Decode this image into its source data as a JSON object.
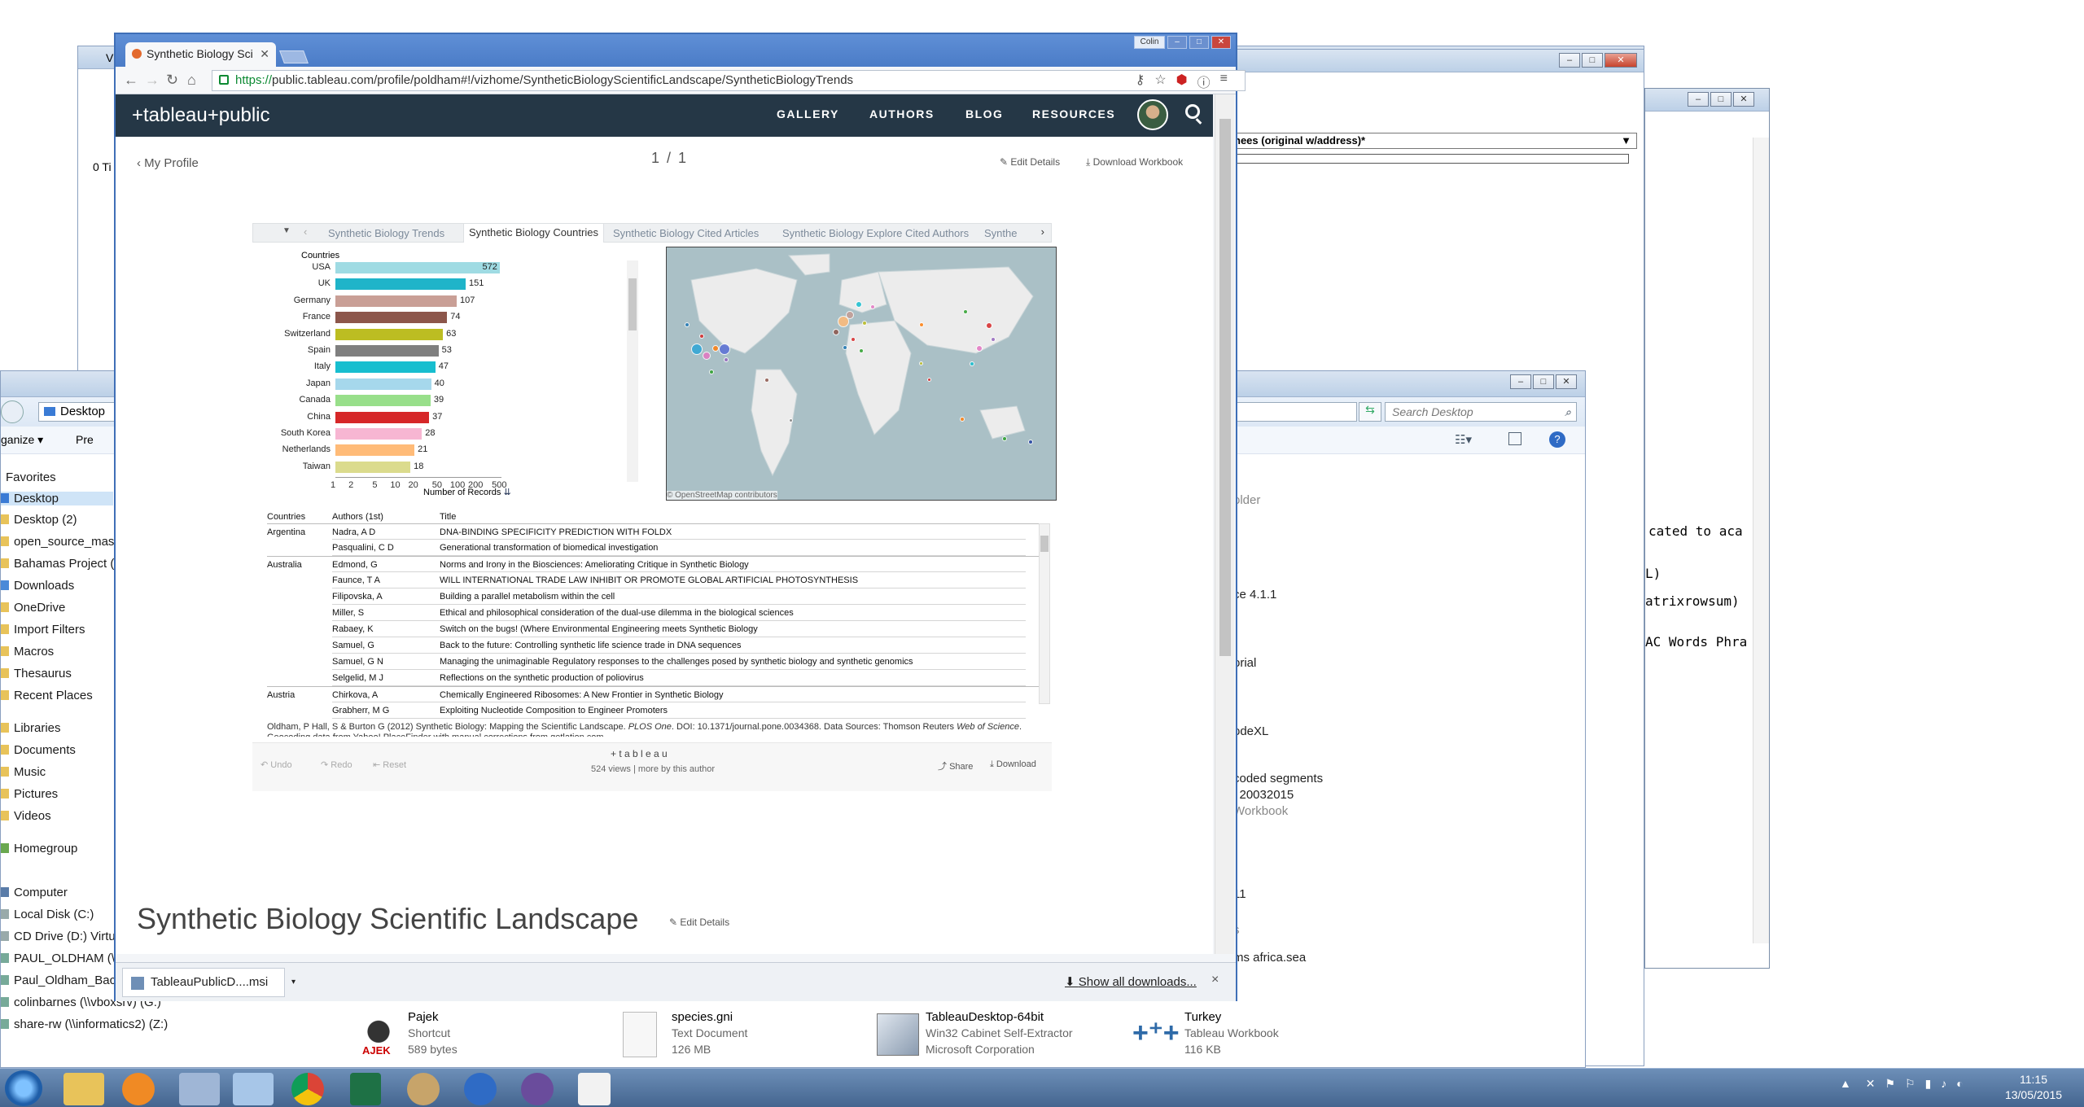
{
  "bg_windows": {
    "back_left_title": "V",
    "tab0_label": "0 Ti",
    "dropdown_label": "hees (original w/address)*",
    "right_text_lines": [
      "cated to aca",
      "L)",
      "atrixrowsum)",
      "AC Words Phra"
    ],
    "explorer_middle_lines": [
      "older",
      "ce 4.1.1",
      "orial",
      "odeXL",
      "coded segments",
      "l 20032015",
      "Workbook",
      "11",
      "s",
      "ms africa.sea"
    ]
  },
  "explorer": {
    "address": "Desktop",
    "search_placeholder": "Search Desktop",
    "toolbar": {
      "organize": "ganize ▾",
      "preview": "Pre"
    },
    "favorites_header": "Favorites",
    "favorites": [
      "Desktop",
      "Desktop (2)",
      "open_source_mast",
      "Bahamas Project (2",
      "Downloads",
      "OneDrive",
      "Import Filters",
      "Macros",
      "Thesaurus",
      "Recent Places"
    ],
    "libraries_header": "Libraries",
    "libraries": [
      "Documents",
      "Music",
      "Pictures",
      "Videos"
    ],
    "homegroup": "Homegroup",
    "computer_header": "Computer",
    "computer": [
      "Local Disk (C:)",
      "CD Drive (D:) Virtu",
      "PAUL_OLDHAM (\\\\",
      "Paul_Oldham_Backup (\\\\vboxsrv) (F:)",
      "colinbarnes (\\\\vboxsrv) (G:)",
      "share-rw (\\\\informatics2) (Z:)"
    ],
    "files": [
      {
        "name": "Pajek",
        "type": "Shortcut",
        "size": "589 bytes"
      },
      {
        "name": "species.gni",
        "type": "Text Document",
        "size": "126 MB"
      },
      {
        "name": "TableauDesktop-64bit",
        "type": "Win32 Cabinet Self-Extractor",
        "size": "Microsoft Corporation"
      },
      {
        "name": "Turkey",
        "type": "Tableau Workbook",
        "size": "116 KB"
      }
    ]
  },
  "browser": {
    "tab_title": "Synthetic Biology Sci",
    "user_chip": "Colin",
    "url_https": "https://",
    "url_rest": "public.tableau.com/profile/poldham#!/vizhome/SyntheticBiologyScientificLandscape/SyntheticBiologyTrends",
    "download_file": "TableauPublicD....msi",
    "show_all_downloads": "Show all downloads...",
    "dl_close": "×"
  },
  "tableau": {
    "logo": "+tableau+public",
    "nav": [
      "GALLERY",
      "AUTHORS",
      "BLOG",
      "RESOURCES"
    ],
    "my_profile": "My Profile",
    "pager": "1 / 1",
    "edit_details": "Edit Details",
    "download_workbook": "Download Workbook",
    "viz_tabs": [
      "Synthetic Biology Trends",
      "Synthetic Biology Countries",
      "Synthetic Biology Cited Articles",
      "Synthetic Biology Explore Cited Authors",
      "Synthe"
    ],
    "active_tab_index": 1,
    "map_credit": "© OpenStreetMap contributors",
    "table": {
      "headers": [
        "Countries",
        "Authors (1st)",
        "Title"
      ],
      "rows": [
        {
          "country": "Argentina",
          "author": "Nadra, A D",
          "title": "DNA-BINDING SPECIFICITY PREDICTION WITH FOLDX"
        },
        {
          "country": "",
          "author": "Pasqualini, C D",
          "title": "Generational transformation of biomedical investigation"
        },
        {
          "country": "Australia",
          "author": "Edmond, G",
          "title": "Norms and Irony in the Biosciences: Ameliorating Critique in Synthetic Biology"
        },
        {
          "country": "",
          "author": "Faunce, T A",
          "title": "WILL INTERNATIONAL TRADE LAW INHIBIT OR PROMOTE GLOBAL ARTIFICIAL PHOTOSYNTHESIS"
        },
        {
          "country": "",
          "author": "Filipovska, A",
          "title": "Building a parallel metabolism within the cell"
        },
        {
          "country": "",
          "author": "Miller, S",
          "title": "Ethical and philosophical consideration of the dual-use dilemma in the biological sciences"
        },
        {
          "country": "",
          "author": "Rabaey, K",
          "title": "Switch on the bugs! (Where Environmental Engineering meets Synthetic Biology"
        },
        {
          "country": "",
          "author": "Samuel, G",
          "title": "Back to the future: Controlling synthetic life science trade in DNA sequences"
        },
        {
          "country": "",
          "author": "Samuel, G N",
          "title": "Managing the unimaginable Regulatory responses to the challenges posed by synthetic biology and synthetic genomics"
        },
        {
          "country": "",
          "author": "Selgelid, M J",
          "title": "Reflections on the synthetic production of poliovirus"
        },
        {
          "country": "Austria",
          "author": "Chirkova, A",
          "title": "Chemically Engineered Ribosomes: A New Frontier in Synthetic Biology"
        },
        {
          "country": "",
          "author": "Grabherr, M G",
          "title": "Exploiting Nucleotide Composition to Engineer Promoters"
        }
      ]
    },
    "citation_1": "Oldham, P Hall, S & Burton G (2012) Synthetic Biology: Mapping the Scientific Landscape. ",
    "citation_journal": "PLOS One",
    "citation_2": ". DOI: 10.1371/journal.pone.0034368. Data Sources: Thomson Reuters ",
    "citation_wos": "Web of Science",
    "citation_3": ". Geocoding data from Yahoo! PlaceFinder with manual corrections from getlation.com",
    "toolbar": {
      "undo": "Undo",
      "redo": "Redo",
      "reset": "Reset",
      "share": "Share",
      "download": "Download"
    },
    "footer_logo": "+ t a b l e a u",
    "views": "524 views",
    "more_by_author": "more by this author",
    "page_title": "Synthetic Biology Scientific Landscape",
    "edit_details_2": "Edit Details"
  },
  "chart_data": {
    "type": "bar",
    "title": "",
    "ylabel": "Countries",
    "xlabel": "Number of Records",
    "x_scale": "log",
    "x_ticks": [
      1,
      2,
      5,
      10,
      20,
      50,
      100,
      200,
      500
    ],
    "categories": [
      "USA",
      "UK",
      "Germany",
      "France",
      "Switzerland",
      "Spain",
      "Italy",
      "Japan",
      "Canada",
      "China",
      "South Korea",
      "Netherlands",
      "Taiwan"
    ],
    "values": [
      572,
      151,
      107,
      74,
      63,
      53,
      47,
      40,
      39,
      37,
      28,
      21,
      18
    ],
    "colors": [
      "#9fdbe3",
      "#1fb4c9",
      "#c99f96",
      "#8c564b",
      "#bcbd22",
      "#7f7f7f",
      "#17becf",
      "#a6d8ec",
      "#98df8a",
      "#d62728",
      "#f7b6d2",
      "#ffbb78",
      "#dbdb8d"
    ]
  },
  "taskbar": {
    "time": "11:15",
    "date": "13/05/2015"
  }
}
